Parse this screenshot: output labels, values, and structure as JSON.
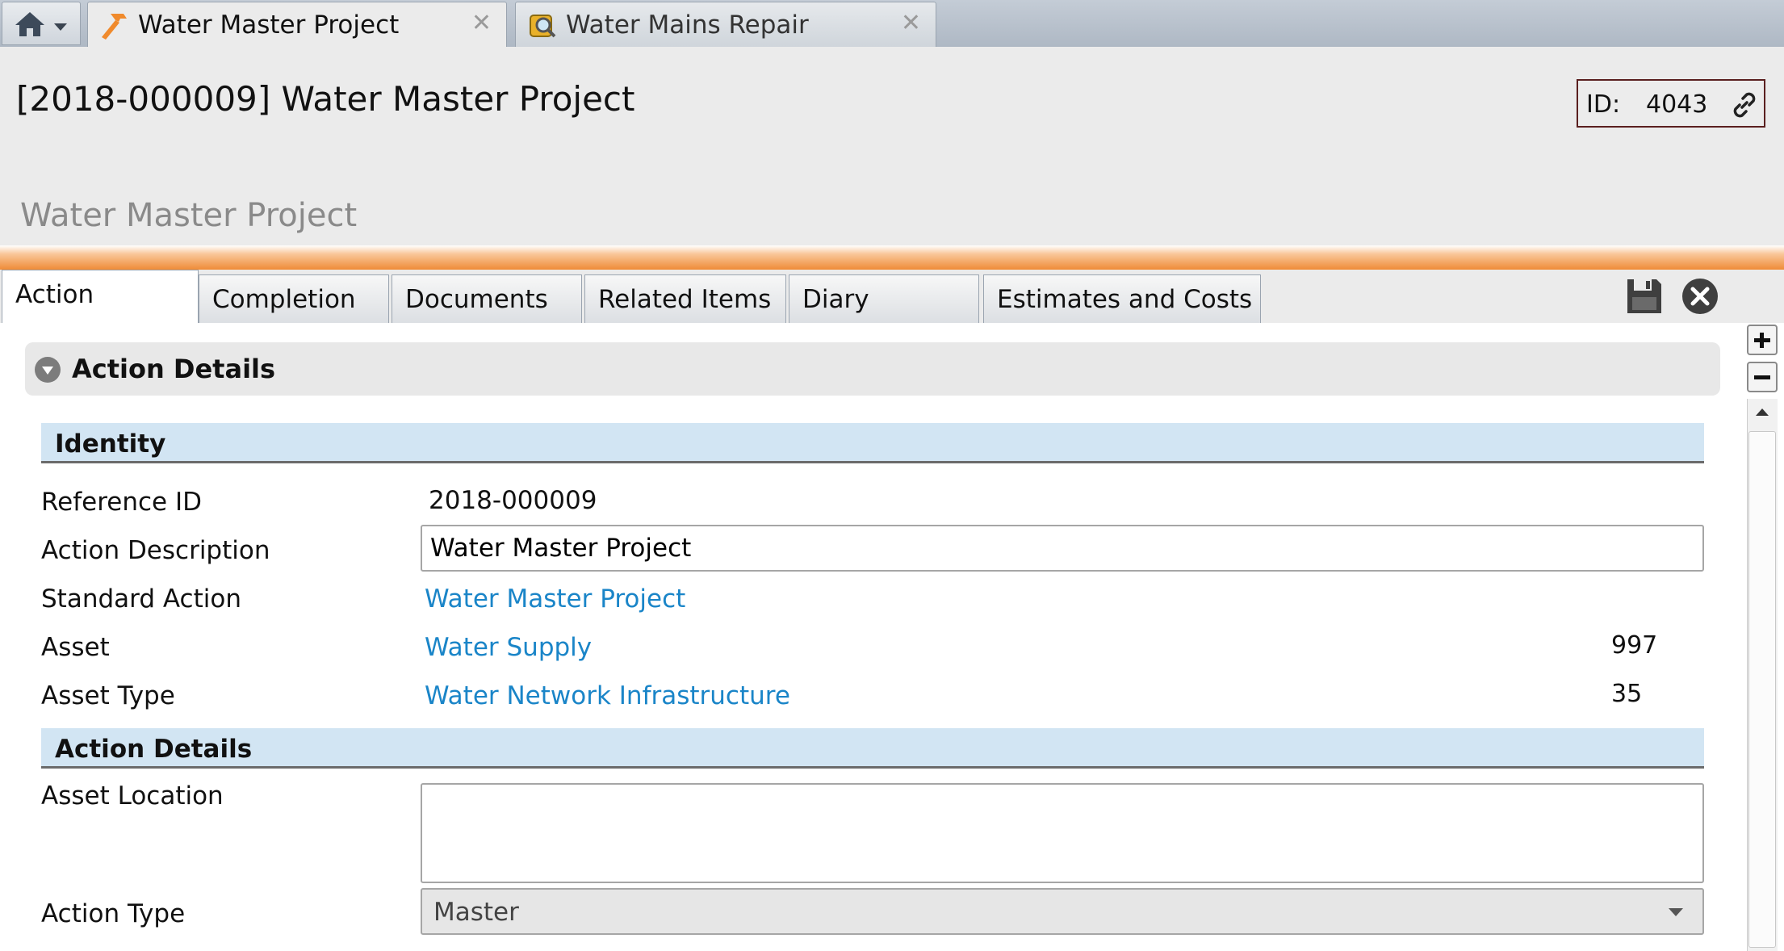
{
  "tabstrip": {
    "tabs": [
      {
        "label": "Water Master Project",
        "icon": "hammer-icon",
        "active": true
      },
      {
        "label": "Water Mains Repair",
        "icon": "inspection-icon",
        "active": false
      }
    ],
    "close_glyph": "✕"
  },
  "header": {
    "title": "[2018-000009] Water Master Project",
    "id_label": "ID:",
    "id_value": "4043",
    "subtitle": "Water Master Project",
    "accent_color": "#ef8b37"
  },
  "form_tabs": [
    {
      "label": "Action",
      "active": true
    },
    {
      "label": "Completion"
    },
    {
      "label": "Documents"
    },
    {
      "label": "Related Items"
    },
    {
      "label": "Diary"
    },
    {
      "label": "Estimates and Costs"
    }
  ],
  "section": {
    "title": "Action Details",
    "groups": {
      "identity": "Identity",
      "action_details": "Action Details"
    }
  },
  "fields": {
    "reference_id": {
      "label": "Reference ID",
      "value": "2018-000009"
    },
    "action_description": {
      "label": "Action Description",
      "value": "Water Master Project"
    },
    "standard_action": {
      "label": "Standard Action",
      "value": "Water Master Project"
    },
    "asset": {
      "label": "Asset",
      "value": "Water Supply",
      "number": "997"
    },
    "asset_type": {
      "label": "Asset Type",
      "value": "Water Network Infrastructure",
      "number": "35"
    },
    "asset_location": {
      "label": "Asset Location",
      "value": ""
    },
    "action_type": {
      "label": "Action Type",
      "value": "Master"
    }
  },
  "colors": {
    "link": "#1a85c8",
    "group_header_bg": "#d2e5f3"
  }
}
